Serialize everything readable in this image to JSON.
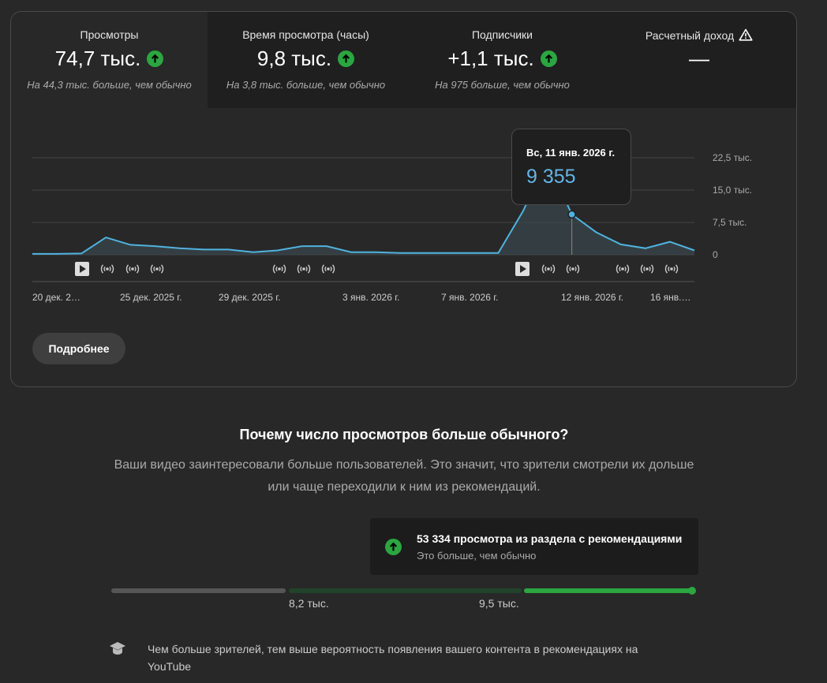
{
  "metrics": [
    {
      "label": "Просмотры",
      "value": "74,7 тыс.",
      "sub": "На 44,3 тыс. больше, чем обычно"
    },
    {
      "label": "Время просмотра (часы)",
      "value": "9,8 тыс.",
      "sub": "На 3,8 тыс. больше, чем обычно"
    },
    {
      "label": "Подписчики",
      "value": "+1,1 тыс.",
      "sub": "На 975 больше, чем обычно"
    },
    {
      "label": "Расчетный доход",
      "value": "—"
    }
  ],
  "chart_data": {
    "type": "area",
    "ytick_labels": [
      "22,5 тыс.",
      "15,0 тыс.",
      "7,5 тыс.",
      "0"
    ],
    "yticks": [
      22500,
      15000,
      7500,
      0
    ],
    "ylim": [
      0,
      22500
    ],
    "xtick_labels": [
      "20 дек. 2…",
      "25 дек. 2025 г.",
      "29 дек. 2025 г.",
      "3 янв. 2026 г.",
      "7 янв. 2026 г.",
      "12 янв. 2026 г.",
      "16 янв.…"
    ],
    "series": [
      {
        "values": [
          200,
          200,
          300,
          4000,
          2300,
          2000,
          1500,
          1200,
          1200,
          600,
          1000,
          2000,
          2000,
          600,
          600,
          400,
          400,
          400,
          400,
          400,
          10000,
          22000,
          9355,
          5200,
          2400,
          1500,
          3000,
          1000
        ]
      }
    ],
    "highlight": {
      "index": 22,
      "date": "Вс, 11 янв. 2026 г.",
      "value": "9 355"
    },
    "color": "#4fb3e0",
    "grid": true
  },
  "more_button": "Подробнее",
  "why": {
    "title": "Почему число просмотров больше обычного?",
    "text": "Ваши видео заинтересовали больше пользователей. Это значит, что зрители смотрели их дольше или чаще переходили к ним из рекомендаций."
  },
  "recommendations": {
    "title": "53 334 просмотра из раздела с рекомендациями",
    "sub": "Это больше, чем обычно",
    "low_label": "8,2 тыс.",
    "high_label": "9,5 тыс."
  },
  "tip": "Чем больше зрителей, тем выше вероятность появления вашего контента в рекомендациях на YouTube",
  "colors": {
    "accent": "#2ba640",
    "chart_line": "#4fb3e0",
    "tooltip_value": "#62b6e8"
  }
}
